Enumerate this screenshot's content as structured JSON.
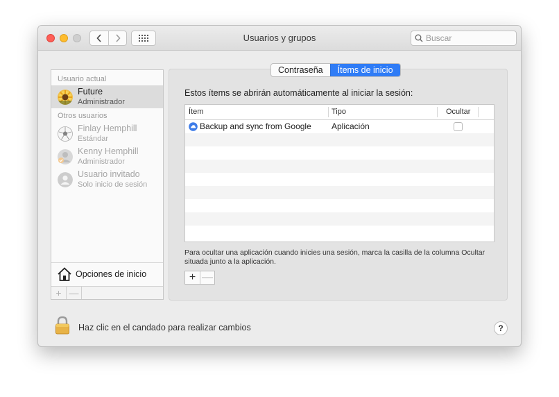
{
  "window": {
    "title": "Usuarios y grupos",
    "search_placeholder": "Buscar"
  },
  "sidebar": {
    "current_header": "Usuario actual",
    "others_header": "Otros usuarios",
    "users": [
      {
        "name": "Future",
        "role": "Administrador",
        "selected": true
      },
      {
        "name": "Finlay Hemphill",
        "role": "Estándar"
      },
      {
        "name": "Kenny Hemphill",
        "role": "Administrador"
      },
      {
        "name": "Usuario invitado",
        "role": "Solo inicio de sesión"
      }
    ],
    "login_options": "Opciones de inicio",
    "add": "+",
    "remove": "—"
  },
  "tabs": [
    {
      "label": "Contraseña",
      "active": false
    },
    {
      "label": "Ítems de inicio",
      "active": true
    }
  ],
  "main": {
    "intro": "Estos ítems se abrirán automáticamente al iniciar la sesión:",
    "columns": [
      "Ítem",
      "Tipo",
      "Ocultar"
    ],
    "rows": [
      {
        "item": "Backup and sync from Google",
        "type": "Aplicación",
        "hide": false
      }
    ],
    "hint": "Para ocultar una aplicación cuando inicies una sesión, marca la casilla de la columna Ocultar situada junto a la aplicación.",
    "add": "+",
    "remove": "—"
  },
  "footer": {
    "lock_text": "Haz clic en el candado para realizar cambios",
    "help": "?"
  },
  "colors": {
    "accent": "#2f7cf6",
    "close": "#fe5f57",
    "minimize": "#febc2e"
  }
}
